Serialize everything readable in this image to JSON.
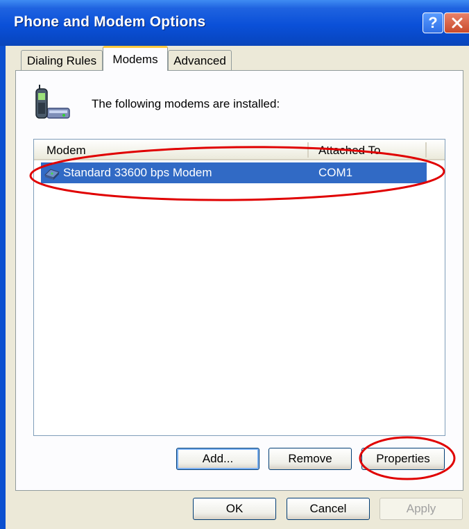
{
  "window": {
    "title": "Phone and Modem Options"
  },
  "tabs": [
    {
      "label": "Dialing Rules"
    },
    {
      "label": "Modems"
    },
    {
      "label": "Advanced"
    }
  ],
  "intro_text": "The following modems are  installed:",
  "modem_list": {
    "columns": [
      "Modem",
      "Attached To"
    ],
    "rows": [
      {
        "name": "Standard 33600 bps Modem",
        "port": "COM1"
      }
    ]
  },
  "panel_buttons": {
    "add": "Add...",
    "remove": "Remove",
    "properties": "Properties"
  },
  "dialog_buttons": {
    "ok": "OK",
    "cancel": "Cancel",
    "apply": "Apply"
  },
  "colors": {
    "titlebar": "#0a50d8",
    "selection": "#316ac5",
    "annotation": "#e00000"
  },
  "icons": [
    "help-icon",
    "close-icon",
    "phone-modem-icon",
    "modem-icon"
  ]
}
